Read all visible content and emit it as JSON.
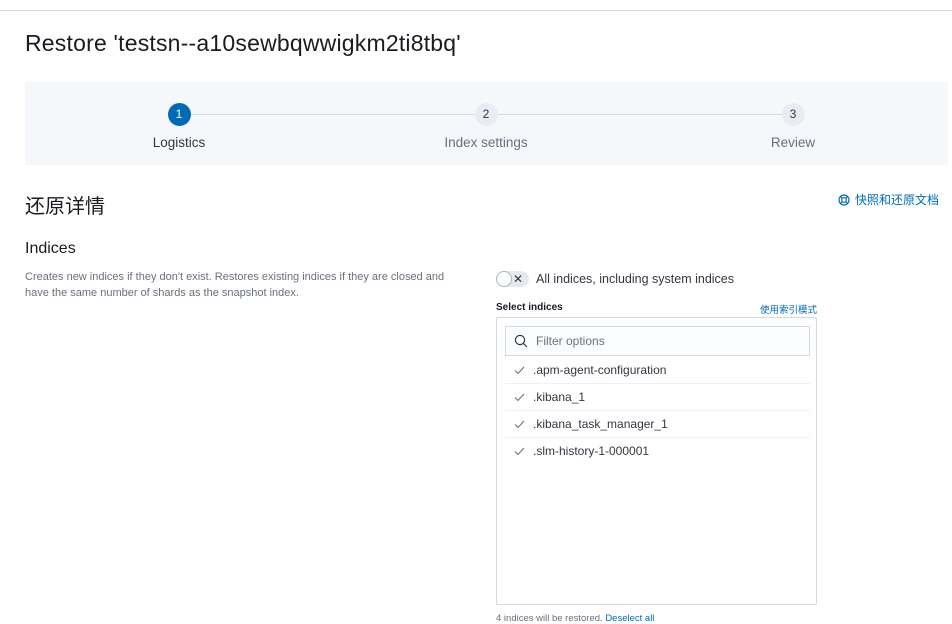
{
  "page": {
    "title": "Restore 'testsn--a10sewbqwwigkm2ti8tbq'"
  },
  "steps": [
    {
      "number": "1",
      "label": "Logistics",
      "active": true
    },
    {
      "number": "2",
      "label": "Index settings",
      "active": false
    },
    {
      "number": "3",
      "label": "Review",
      "active": false
    }
  ],
  "section": {
    "title": "还原详情",
    "docs_link": "快照和还原文档"
  },
  "indices": {
    "title": "Indices",
    "description": "Creates new indices if they don't exist. Restores existing indices if they are closed and have the same number of shards as the snapshot index.",
    "switch_label": "All indices, including system indices",
    "switch_on": false,
    "select_label": "Select indices",
    "mode_link": "使用索引模式",
    "filter_placeholder": "Filter options",
    "options": [
      ".apm-agent-configuration",
      ".kibana_1",
      ".kibana_task_manager_1",
      ".slm-history-1-000001"
    ],
    "footer_text": "4 indices will be restored.",
    "footer_link": "Deselect all"
  },
  "colors": {
    "accent": "#006bb4",
    "panel_bg": "#f5f7fa",
    "border": "#d3dae6"
  },
  "icons": {
    "docs": "help-lifebuoy-icon",
    "filter": "search-icon",
    "option": "check-icon",
    "switch": "cross-icon"
  }
}
